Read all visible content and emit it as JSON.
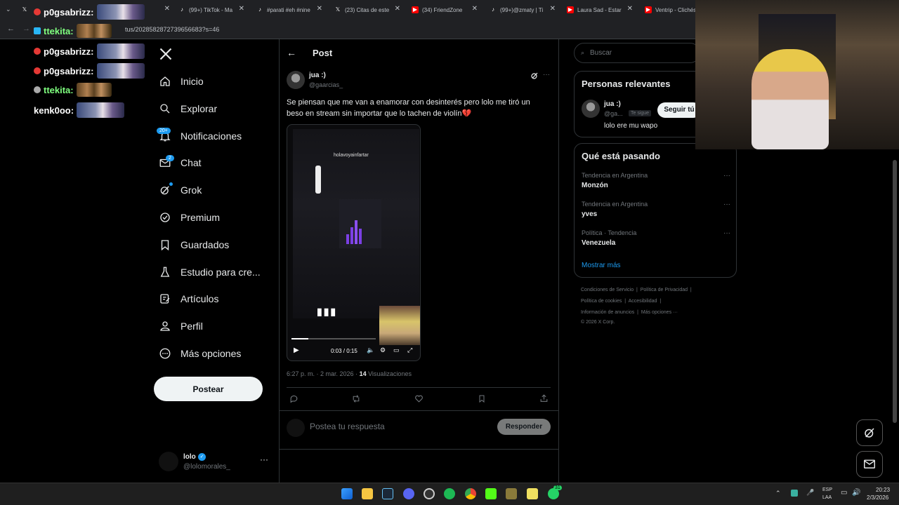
{
  "browser": {
    "tabs": [
      {
        "label": "(23) Citas de este",
        "icon": "x-logo"
      },
      {
        "label": "(99+) TikTok - Ma",
        "icon": "tiktok-logo"
      },
      {
        "label": "#parati #eh #nine",
        "icon": "tiktok-logo"
      },
      {
        "label": "(34) FriendZone",
        "icon": "youtube-logo"
      },
      {
        "label": "(99+)@zmaty | Ti",
        "icon": "tiktok-logo"
      },
      {
        "label": "Laura Sad - Estar",
        "icon": "youtube-logo"
      },
      {
        "label": "Ventrip - Clichés",
        "icon": "youtube-logo"
      }
    ],
    "url": "tus/2028582872739656683?s=46"
  },
  "overlay_chat": [
    {
      "user": "p0gsabrizz:",
      "color": "#ffffff"
    },
    {
      "user": "ttekita:",
      "color": "#7fff7f"
    },
    {
      "user": "p0gsabrizz:",
      "color": "#ffffff"
    },
    {
      "user": "p0gsabrizz:",
      "color": "#ffffff"
    },
    {
      "user": "ttekita:",
      "color": "#7fff7f"
    },
    {
      "user": "kenk0oo:",
      "color": "#ffffff"
    }
  ],
  "nav": {
    "items": [
      {
        "label": "Inicio",
        "icon": "home-icon"
      },
      {
        "label": "Explorar",
        "icon": "search-icon"
      },
      {
        "label": "Notificaciones",
        "icon": "bell-icon",
        "badge": "20+"
      },
      {
        "label": "Chat",
        "icon": "mail-icon",
        "badge": "2"
      },
      {
        "label": "Grok",
        "icon": "grok-icon"
      },
      {
        "label": "Premium",
        "icon": "verified-icon"
      },
      {
        "label": "Guardados",
        "icon": "bookmark-icon"
      },
      {
        "label": "Estudio para cre...",
        "icon": "studio-icon"
      },
      {
        "label": "Artículos",
        "icon": "article-icon"
      },
      {
        "label": "Perfil",
        "icon": "person-icon"
      },
      {
        "label": "Más opciones",
        "icon": "more-circle-icon"
      }
    ],
    "post_button": "Postear",
    "account": {
      "name": "lolo",
      "handle": "@lolomorales_"
    }
  },
  "post": {
    "header": "Post",
    "author": {
      "name": "jua :)",
      "handle": "@gaarcias_"
    },
    "text": "Se piensan que me van a enamorar con desinterés pero lolo me tiró un beso en stream sin importar que lo tachen de violín💔",
    "video": {
      "overlay_title": "holavoyainfartar",
      "time": "0:03 / 0:15",
      "progress": 0.2
    },
    "timestamp": "6:27 p. m. · 2 mar. 2026 · ",
    "views_count": "14",
    "views_label": " Visualizaciones",
    "reply_placeholder": "Postea tu respuesta",
    "reply_button": "Responder"
  },
  "right": {
    "search_placeholder": "Buscar",
    "relevant": {
      "title": "Personas relevantes",
      "name": "jua :)",
      "handle": "@ga...",
      "follows_you": "Te sigue",
      "follow_button": "Seguir tú",
      "bio": "lolo ere mu wapo"
    },
    "trending": {
      "title": "Qué está pasando",
      "items": [
        {
          "meta": "Tendencia en Argentina",
          "name": "Monzón"
        },
        {
          "meta": "Tendencia en Argentina",
          "name": "yves"
        },
        {
          "meta": "Política · Tendencia",
          "name": "Venezuela"
        }
      ],
      "more": "Mostrar más"
    },
    "footer": {
      "line1": [
        "Condiciones de Servicio",
        "Política de Privacidad"
      ],
      "line2": [
        "Política de cookies",
        "Accesibilidad"
      ],
      "line3": [
        "Información de anuncios",
        "Más opciones ···"
      ],
      "copyright": "© 2026 X Corp."
    }
  },
  "taskbar": {
    "lang1": "ESP",
    "lang2": "LAA",
    "time": "20:23",
    "date": "2/3/2026",
    "whatsapp_badge": "31"
  }
}
